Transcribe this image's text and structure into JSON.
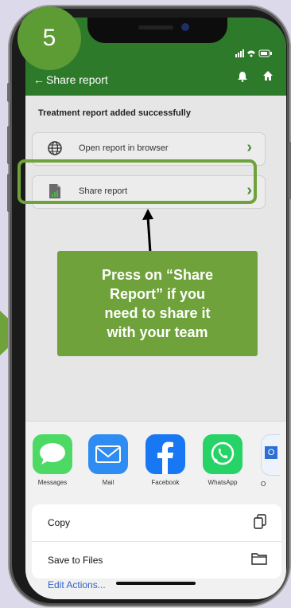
{
  "step_number": "5",
  "appbar": {
    "back_glyph": "←",
    "title": "Share report"
  },
  "message": "Treatment report added successfully",
  "options": [
    {
      "label": "Open report in browser",
      "icon": "globe-icon"
    },
    {
      "label": "Share report",
      "icon": "document-icon"
    }
  ],
  "callout": {
    "text": "Press on “Share\nReport” if you\nneed to share it\nwith your team"
  },
  "share_sheet": {
    "apps": [
      {
        "name": "Messages",
        "color": "#4cd964",
        "icon": "message-bubble-icon"
      },
      {
        "name": "Mail",
        "color": "#2f8cf2",
        "icon": "mail-icon"
      },
      {
        "name": "Facebook",
        "color": "#1877f2",
        "icon": "facebook-icon"
      },
      {
        "name": "WhatsApp",
        "color": "#25d366",
        "icon": "whatsapp-icon"
      },
      {
        "name": "O",
        "color": "#2d6fd6",
        "icon": "more-app-icon"
      }
    ],
    "actions": [
      {
        "label": "Copy",
        "icon": "copy-icon"
      },
      {
        "label": "Save to Files",
        "icon": "folder-icon"
      }
    ],
    "edit_label": "Edit Actions..."
  },
  "colors": {
    "brand": "#2e7a2b",
    "accent": "#6fa23a",
    "link": "#2f63c8"
  }
}
